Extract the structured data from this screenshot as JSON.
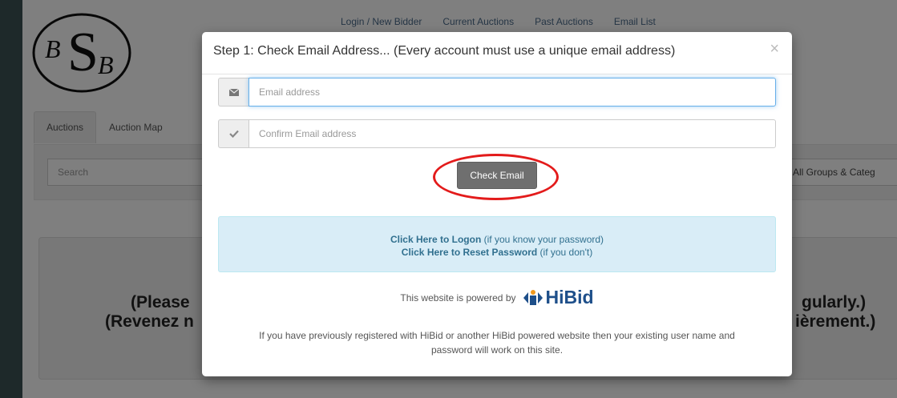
{
  "site": {
    "logo_text": "BSB",
    "nav": [
      "Login / New Bidder",
      "Current Auctions",
      "Past Auctions",
      "Email List"
    ],
    "tabs": [
      "Auctions",
      "Auction Map"
    ],
    "search_placeholder": "Search",
    "groups_select": "All Groups & Categ",
    "notice_left_1": "(Please",
    "notice_left_2": "(Revenez n",
    "notice_right_1": "gularly.)",
    "notice_right_2": "ièrement.)"
  },
  "modal": {
    "title": "Step 1: Check Email Address... (Every account must use a unique email address)",
    "close": "×",
    "email_placeholder": "Email address",
    "confirm_placeholder": "Confirm Email address",
    "check_button": "Check Email",
    "logon_link": "Click Here to Logon",
    "logon_note": "(if you know your password)",
    "reset_link": "Click Here to Reset Password",
    "reset_note": "(if you don't)",
    "powered_by": "This website is powered by",
    "brand": "HiBid",
    "footnote_1": "If you have previously registered with HiBid or another HiBid powered website then your existing user name and",
    "footnote_2": "password will work on this site."
  },
  "colors": {
    "highlight": "#e31b1b",
    "info_bg": "#d9edf7",
    "brand_blue": "#1e4f8a",
    "button": "#6f6f6f"
  },
  "icons": [
    "envelope-icon",
    "checkmark-icon",
    "hibid-logo-icon"
  ]
}
